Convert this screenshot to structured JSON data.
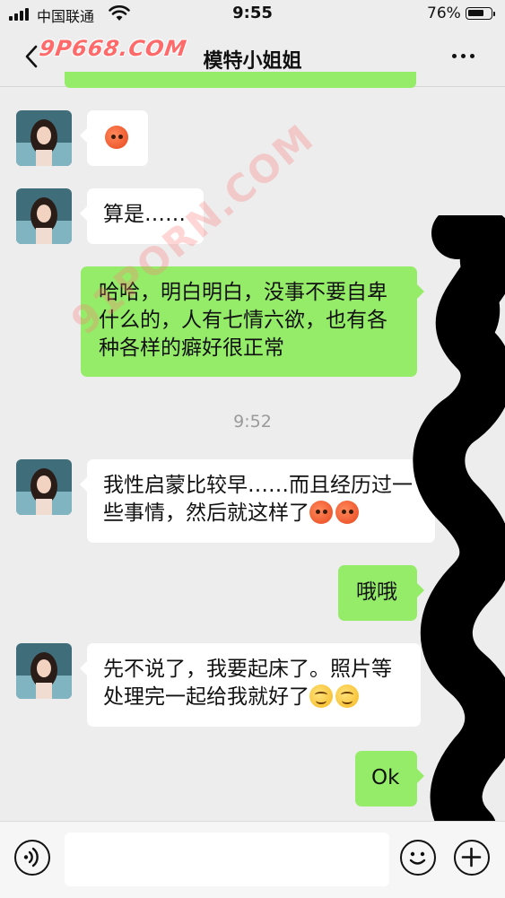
{
  "status_bar": {
    "carrier": "中国联通",
    "time": "9:55",
    "battery_percent": "76%",
    "battery_level": 0.76
  },
  "nav": {
    "title": "模特小姐姐",
    "back_icon": "chevron-left-icon",
    "more_icon": "more-dots-icon"
  },
  "watermarks": {
    "top": "9P668.COM",
    "diagonal": "91PORN.COM"
  },
  "messages": [
    {
      "side": "left",
      "sender": "模特小姐姐",
      "text": "",
      "emoji": [
        "hot-face"
      ]
    },
    {
      "side": "left",
      "sender": "模特小姐姐",
      "text": "算是……"
    },
    {
      "side": "right",
      "sender": "me",
      "text": "哈哈，明白明白，没事不要自卑什么的，人有七情六欲，也有各种各样的癖好很正常"
    },
    {
      "side": "left",
      "sender": "模特小姐姐",
      "text": "我性启蒙比较早……而且经历过一些事情，然后就这样了",
      "emoji": [
        "hot-face",
        "hot-face"
      ]
    },
    {
      "side": "right",
      "sender": "me",
      "text": "哦哦"
    },
    {
      "side": "left",
      "sender": "模特小姐姐",
      "text": "先不说了，我要起床了。照片等处理完一起给我就好了",
      "emoji": [
        "smiling-face",
        "smiling-face"
      ]
    },
    {
      "side": "right",
      "sender": "me",
      "text": "Ok"
    }
  ],
  "timestamp": "9:52",
  "input_bar": {
    "voice_icon": "voice-icon",
    "emoji_icon": "emoji-icon",
    "plus_icon": "plus-icon",
    "text_value": ""
  },
  "colors": {
    "background": "#ededed",
    "bubble_left": "#ffffff",
    "bubble_right": "#95ec69",
    "watermark": "#ff6b6b"
  }
}
